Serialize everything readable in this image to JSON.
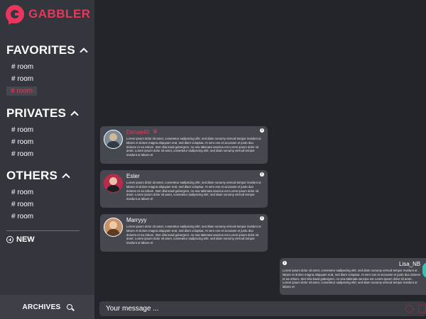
{
  "app": {
    "name": "GABBLER"
  },
  "sidebar": {
    "favorites": {
      "title": "FAVORITES",
      "rooms": [
        "# room",
        "# room",
        "# room"
      ]
    },
    "privates": {
      "title": "PRIVATES",
      "rooms": [
        "# room",
        "# room",
        "# room"
      ]
    },
    "others": {
      "title": "OTHERS",
      "rooms": [
        "# room",
        "# room",
        "# room"
      ]
    },
    "new_label": "NEW",
    "archives_label": "ARCHIVES"
  },
  "messages": [
    {
      "author": "Danae45",
      "author_color": "#e8365d",
      "badge": "star-icon",
      "text": "Lorem ipsum dolor sit amet, consetetur sadipscing elitr, sed diam nonumy eirmod tempor invidunt ut labore et dolore magna aliquyam erat, sed diam voluptua. At vero eos et accusam et justo duo dolores et ea rebum. Stet clita kasd gubergren, no sea takimata sanctus est Lorem ipsum dolor sit amet. Lorem ipsum dolor sit amet, consetetur sadipscing elitr, sed diam nonumy eirmod tempor invidunt ut labore et"
    },
    {
      "author": "Ester",
      "author_color": "#ffffff",
      "text": "Lorem ipsum dolor sit amet, consetetur sadipscing elitr, sed diam nonumy eirmod tempor invidunt ut labore et dolore magna aliquyam erat, sed diam voluptua. At vero eos et accusam et justo duo dolores et ea rebum. Stet clita kasd gubergren, no sea takimata sanctus est Lorem ipsum dolor sit amet. Lorem ipsum dolor sit amet, consetetur sadipscing elitr, sed diam nonumy eirmod tempor invidunt ut labore et"
    },
    {
      "author": "Marryyy",
      "author_color": "#ffffff",
      "text": "Lorem ipsum dolor sit amet, consetetur sadipscing elitr, sed diam nonumy eirmod tempor invidunt ut labore et dolore magna aliquyam erat, sed diam voluptua. At vero eos et accusam et justo duo dolores et ea rebum. Stet clita kasd gubergren, no sea takimata sanctus est Lorem ipsum dolor sit amet. Lorem ipsum dolor sit amet, consetetur sadipscing elitr, sed diam nonumy eirmod tempor invidunt ut labore et"
    },
    {
      "author": "Lisa_NB",
      "author_color": "#ffffff",
      "text": "Lorem ipsum dolor sit amet, consetetur sadipscing elitr, sed diam nonumy eirmod tempor invidunt ut labore et dolore magna aliquyam erat, sed diam voluptua. At vero eos et accusam et justo duo dolores et ea rebum. Stet clita kasd gubergren, no sea takimata sanctus est Lorem ipsum dolor sit amet. Lorem ipsum dolor sit amet, consetetur sadipscing elitr, sed diam nonumy eirmod tempor invidunt ut labore et"
    }
  ],
  "composer": {
    "placeholder": "Your message ..."
  },
  "colors": {
    "accent": "#e8365d",
    "sidebar_bg": "#33363c",
    "main_bg": "#23252a",
    "bubble_bg": "#45484f"
  }
}
